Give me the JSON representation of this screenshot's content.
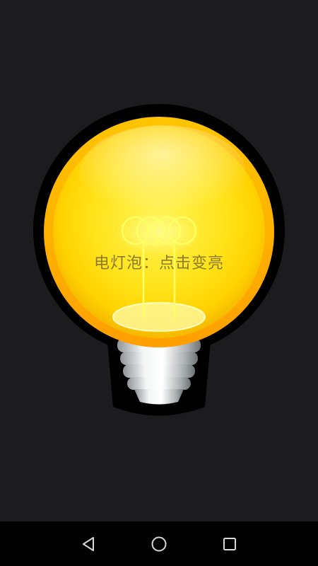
{
  "bulb": {
    "label": "电灯泡：点击变亮",
    "glass_color": "#ffe21a",
    "rim_color": "#ffb000",
    "filament_color": "#ffff66"
  },
  "nav": {
    "back_icon": "back-triangle-icon",
    "home_icon": "home-circle-icon",
    "recent_icon": "recent-square-icon"
  }
}
